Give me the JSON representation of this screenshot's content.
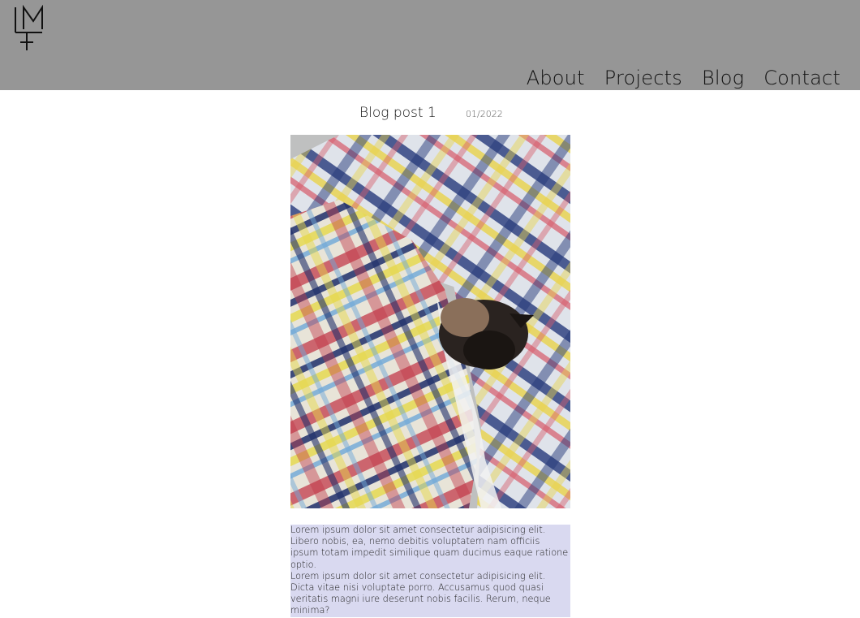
{
  "header": {
    "logo_alt": "LM logo",
    "nav": [
      {
        "label": "About"
      },
      {
        "label": "Projects"
      },
      {
        "label": "Blog"
      },
      {
        "label": "Contact"
      }
    ],
    "background": "#969696"
  },
  "post": {
    "title": "Blog post 1",
    "date": "01/2022",
    "image_icon": "cat-on-plaid-blanket-photo",
    "paragraphs": [
      "Lorem ipsum dolor sit amet consectetur adipisicing elit. Libero nobis, ea, nemo debitis voluptatem nam officiis ipsum totam impedit similique quam ducimus eaque ratione optio.",
      "Lorem ipsum dolor sit amet consectetur adipisicing elit. Dicta vitae nisi voluptate porro. Accusamus quod quasi veritatis magni iure deserunt nobis facilis. Rerum, neque minima?"
    ],
    "body_background": "#d9d9f0"
  }
}
